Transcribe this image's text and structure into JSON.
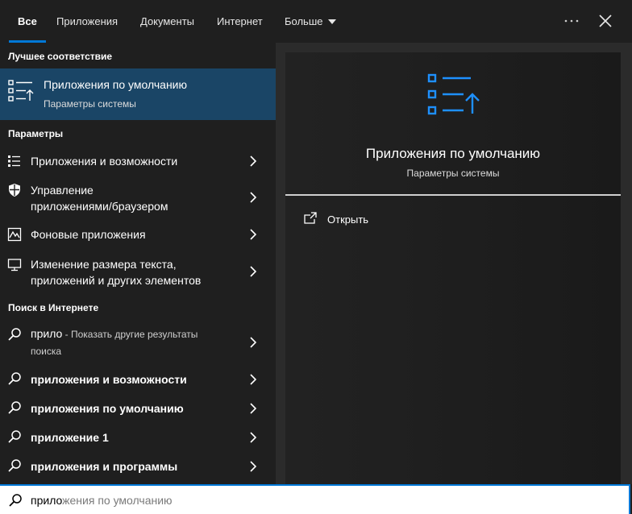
{
  "tabs": [
    {
      "label": "Все"
    },
    {
      "label": "Приложения"
    },
    {
      "label": "Документы"
    },
    {
      "label": "Интернет"
    },
    {
      "label": "Больше"
    }
  ],
  "sections": {
    "best_match": "Лучшее соответствие",
    "settings": "Параметры",
    "web": "Поиск в Интернете"
  },
  "best_match": {
    "title": "Приложения по умолчанию",
    "subtitle": "Параметры системы",
    "icon": "default-apps-icon"
  },
  "settings_items": [
    {
      "label": "Приложения и возможности",
      "icon": "apps-features-icon"
    },
    {
      "label_line1": "Управление",
      "label_line2": "приложениями/браузером",
      "icon": "shield-icon"
    },
    {
      "label": "Фоновые приложения",
      "icon": "background-apps-icon"
    },
    {
      "label_line1": "Изменение размера текста,",
      "label_line2": "приложений и других элементов",
      "icon": "display-icon"
    }
  ],
  "web_items": [
    {
      "query": "прило",
      "suffix": " - Показать другие результаты",
      "suffix2": "поиска",
      "icon": "search-icon"
    },
    {
      "label": "приложения и возможности",
      "icon": "search-icon"
    },
    {
      "label": "приложения по умолчанию",
      "icon": "search-icon"
    },
    {
      "label": "приложение 1",
      "icon": "search-icon"
    },
    {
      "label": "приложения и программы",
      "icon": "search-icon"
    }
  ],
  "preview": {
    "title": "Приложения по умолчанию",
    "subtitle": "Параметры системы",
    "open_label": "Открыть"
  },
  "search": {
    "typed": "прило",
    "suggestion": "жения по умолчанию"
  },
  "colors": {
    "accent": "#0078d7",
    "selected_bg": "#1a4566",
    "panel_bg": "#1f1f1f"
  }
}
